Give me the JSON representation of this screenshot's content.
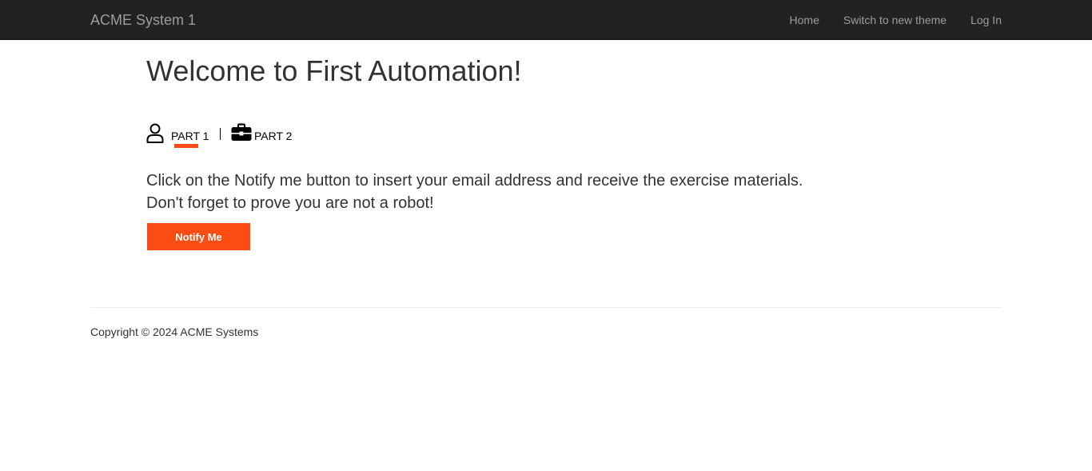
{
  "navbar": {
    "brand": "ACME System 1",
    "links": [
      {
        "label": "Home"
      },
      {
        "label": "Switch to new theme"
      },
      {
        "label": "Log In"
      }
    ]
  },
  "main": {
    "title": "Welcome to First Automation!",
    "tabs": [
      {
        "label": "PART 1",
        "icon": "user-icon",
        "active": true
      },
      {
        "label": "PART 2",
        "icon": "briefcase-icon",
        "active": false
      }
    ],
    "instructions": [
      "Click on the Notify me button to insert your email address and receive the exercise materials.",
      "Don't forget to prove you are not a robot!"
    ],
    "notify_button": "Notify Me"
  },
  "footer": {
    "copyright": "Copyright © 2024 ACME Systems"
  },
  "colors": {
    "navbar_bg": "#222222",
    "nav_text": "#9d9d9d",
    "accent": "#fc4c13",
    "text": "#333333"
  }
}
